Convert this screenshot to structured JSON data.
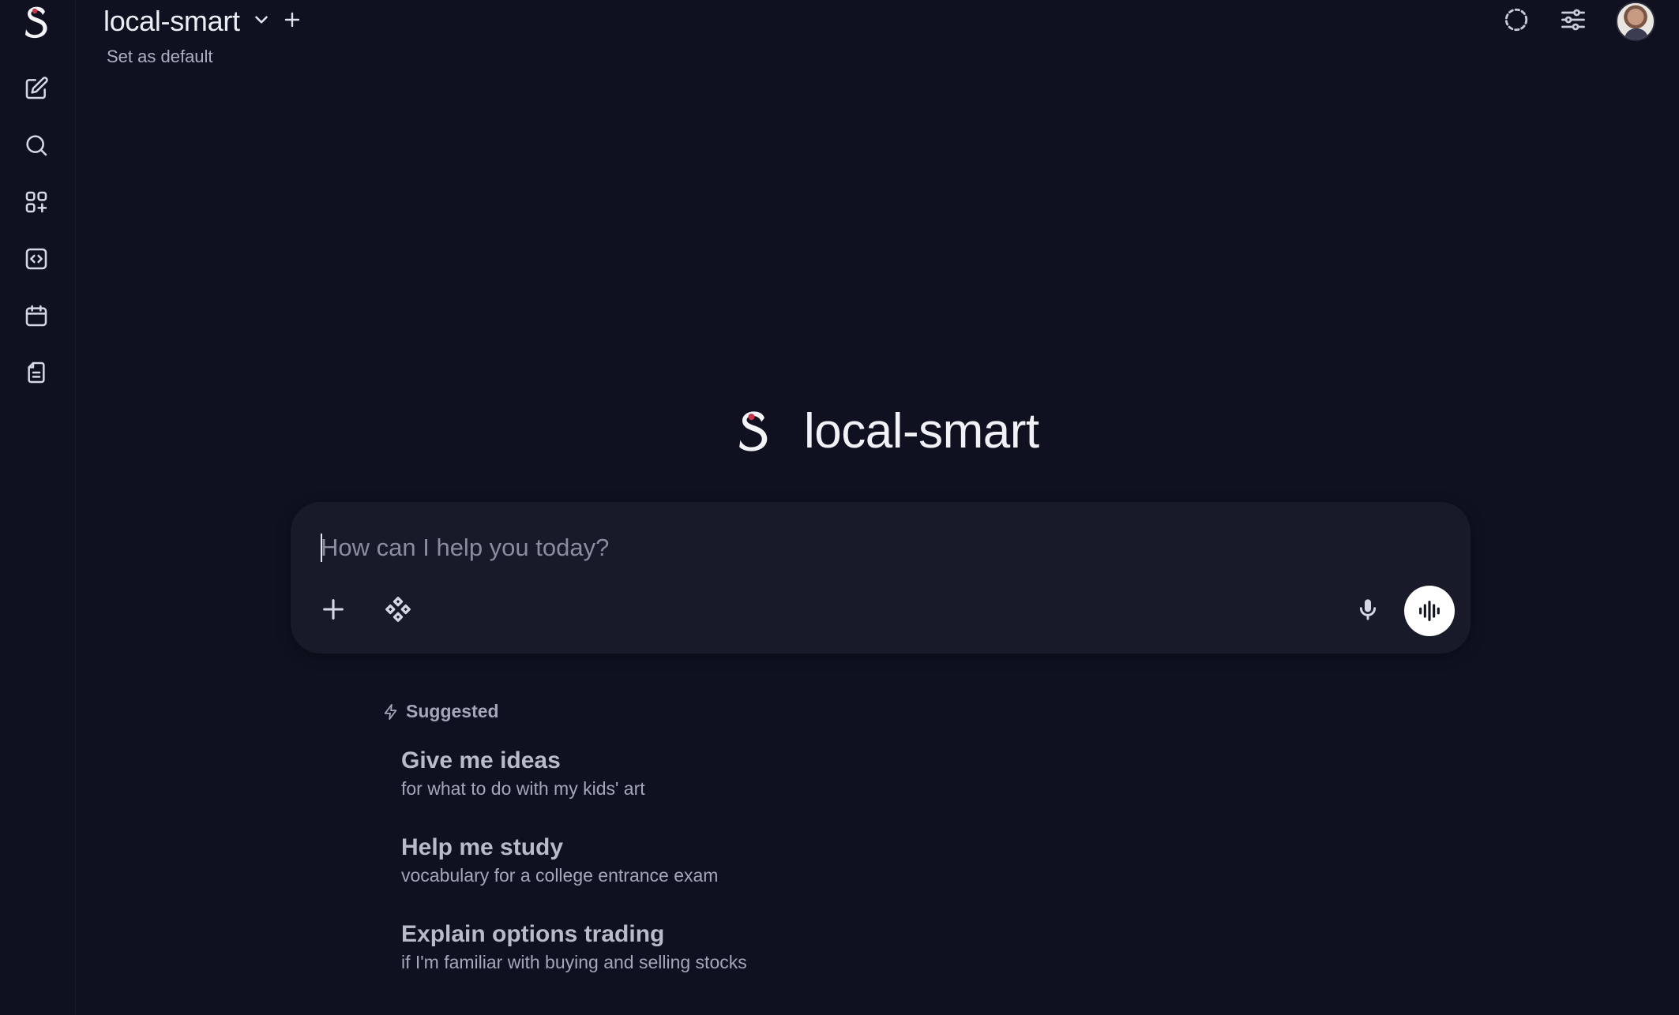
{
  "app": {
    "model_name": "local-smart",
    "set_default_label": "Set as default",
    "hero_title": "local-smart"
  },
  "sidebar": {
    "items": [
      {
        "name": "new-chat",
        "icon": "pencil-square-icon"
      },
      {
        "name": "search",
        "icon": "search-icon"
      },
      {
        "name": "workspace",
        "icon": "grid-plus-icon"
      },
      {
        "name": "code",
        "icon": "code-square-icon"
      },
      {
        "name": "calendar",
        "icon": "calendar-icon"
      },
      {
        "name": "notes",
        "icon": "document-icon"
      }
    ]
  },
  "header": {
    "icons": [
      "temporary-chat-icon",
      "settings-sliders-icon",
      "avatar"
    ]
  },
  "composer": {
    "placeholder": "How can I help you today?",
    "value": ""
  },
  "suggestions": {
    "heading": "Suggested",
    "items": [
      {
        "title": "Give me ideas",
        "subtitle": "for what to do with my kids' art"
      },
      {
        "title": "Help me study",
        "subtitle": "vocabulary for a college entrance exam"
      },
      {
        "title": "Explain options trading",
        "subtitle": "if I'm familiar with buying and selling stocks"
      }
    ]
  },
  "colors": {
    "background": "#0f1120",
    "composer": "#181a2a",
    "logo_accent": "#c2354a",
    "text_primary": "#eceef5",
    "text_muted": "#a4a7b8"
  }
}
